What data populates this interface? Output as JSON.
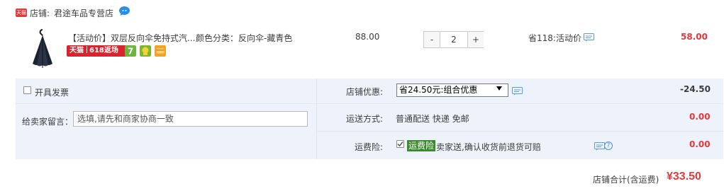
{
  "shop": {
    "badge": "天猫",
    "label": "店铺:",
    "name": "君途车品专营店"
  },
  "item": {
    "title": "【活动价】双层反向伞免持式汽...",
    "attr": "颜色分类：反向伞-藏青色",
    "tag_brand": "天猫",
    "tag_promo": "618返场",
    "unit_price": "88.00",
    "quantity": "2",
    "qty_minus": "-",
    "qty_plus": "+",
    "promo": "省118:活动价",
    "subtotal": "58.00"
  },
  "options": {
    "invoice_label": "开具发票",
    "message_label": "给卖家留言：",
    "message_placeholder": "选填,请先和商家协商一致",
    "discount_label": "店铺优惠:",
    "discount_selected": "省24.50元:组合优惠",
    "discount_value": "-24.50",
    "shipping_label": "运送方式:",
    "shipping_info": "普通配送 快递 免邮",
    "shipping_fee": "0.00",
    "insurance_label": "运费险:",
    "insurance_tag": "运费险",
    "insurance_text": "卖家送,确认收货前退货可赔",
    "insurance_fee": "0.00"
  },
  "total": {
    "label": "店铺合计(含运费)",
    "value": "¥33.50"
  },
  "colors": {
    "accent": "#e4393c",
    "panel_bg": "#eef3fb",
    "insurance_tag": "#3b8a2d"
  }
}
